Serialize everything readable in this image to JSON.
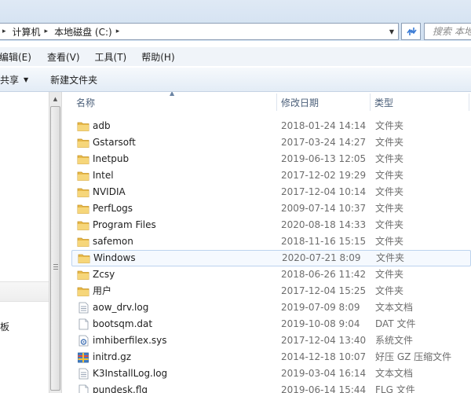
{
  "address": {
    "crumbs": [
      "计算机",
      "本地磁盘 (C:)"
    ],
    "search_placeholder": "搜索 本地"
  },
  "menu": [
    "编辑(E)",
    "查看(V)",
    "工具(T)",
    "帮助(H)"
  ],
  "toolbar": {
    "share_label": "共享",
    "new_folder_label": "新建文件夹"
  },
  "nav": {
    "partial_label": "板"
  },
  "columns": {
    "name": "名称",
    "date": "修改日期",
    "type": "类型"
  },
  "files": [
    {
      "name": "adb",
      "date": "2018-01-24 14:14",
      "type": "文件夹",
      "icon": "folder"
    },
    {
      "name": "Gstarsoft",
      "date": "2017-03-24 14:27",
      "type": "文件夹",
      "icon": "folder"
    },
    {
      "name": "Inetpub",
      "date": "2019-06-13 12:05",
      "type": "文件夹",
      "icon": "folder"
    },
    {
      "name": "Intel",
      "date": "2017-12-02 19:29",
      "type": "文件夹",
      "icon": "folder"
    },
    {
      "name": "NVIDIA",
      "date": "2017-12-04 10:14",
      "type": "文件夹",
      "icon": "folder"
    },
    {
      "name": "PerfLogs",
      "date": "2009-07-14 10:37",
      "type": "文件夹",
      "icon": "folder"
    },
    {
      "name": "Program Files",
      "date": "2020-08-18 14:33",
      "type": "文件夹",
      "icon": "folder"
    },
    {
      "name": "safemon",
      "date": "2018-11-16 15:15",
      "type": "文件夹",
      "icon": "folder"
    },
    {
      "name": "Windows",
      "date": "2020-07-21 8:09",
      "type": "文件夹",
      "icon": "folder",
      "selected": true
    },
    {
      "name": "Zcsy",
      "date": "2018-06-26 11:42",
      "type": "文件夹",
      "icon": "folder"
    },
    {
      "name": "用户",
      "date": "2017-12-04 15:25",
      "type": "文件夹",
      "icon": "folder"
    },
    {
      "name": "aow_drv.log",
      "date": "2019-07-09 8:09",
      "type": "文本文档",
      "icon": "text-file"
    },
    {
      "name": "bootsqm.dat",
      "date": "2019-10-08 9:04",
      "type": "DAT 文件",
      "icon": "blank-file"
    },
    {
      "name": "imhiberfilex.sys",
      "date": "2017-12-04 13:40",
      "type": "系统文件",
      "icon": "system-file"
    },
    {
      "name": "initrd.gz",
      "date": "2014-12-18 10:07",
      "type": "好压 GZ 压缩文件",
      "icon": "archive-file"
    },
    {
      "name": "K3InstallLog.log",
      "date": "2019-03-04 16:14",
      "type": "文本文档",
      "icon": "text-file"
    },
    {
      "name": "pundesk.flg",
      "date": "2019-06-14 15:44",
      "type": "FLG 文件",
      "icon": "blank-file"
    }
  ]
}
